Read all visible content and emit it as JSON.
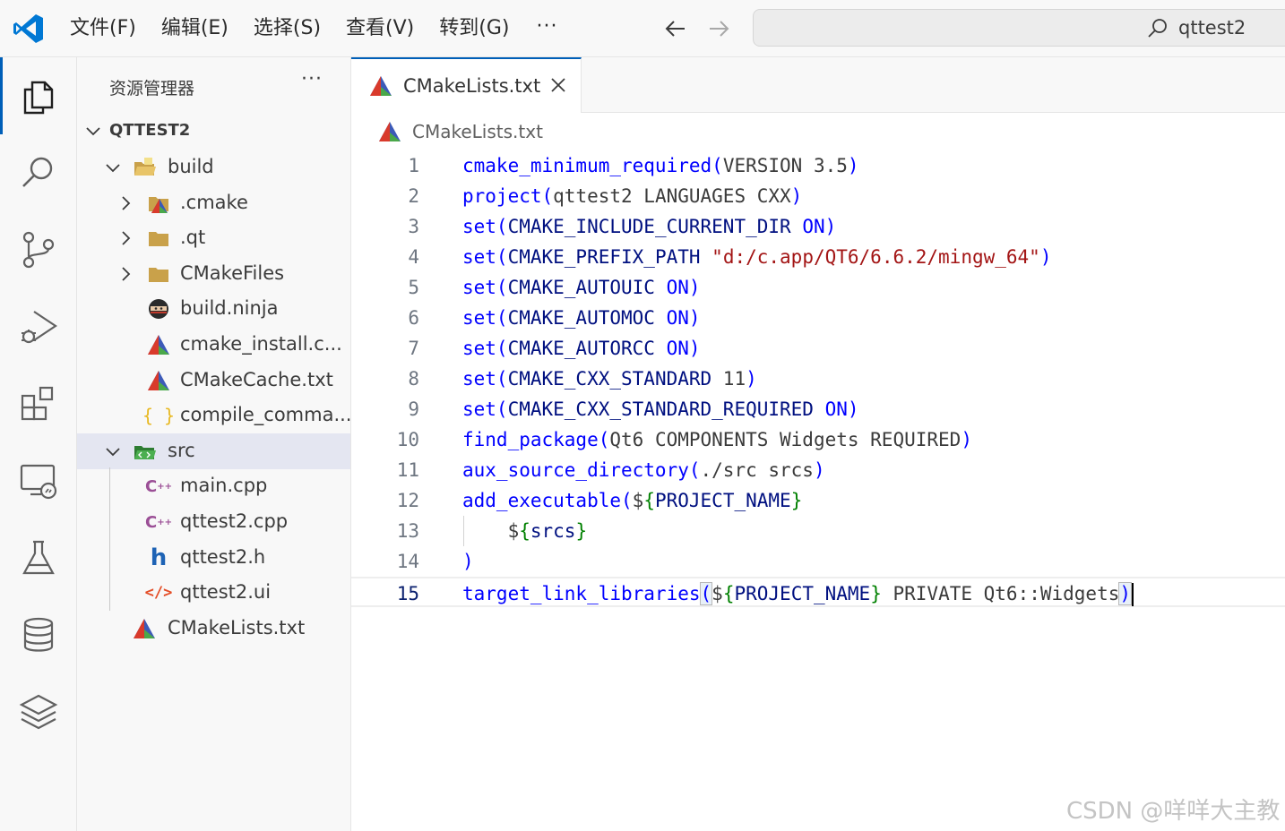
{
  "menu": {
    "items": [
      "文件(F)",
      "编辑(E)",
      "选择(S)",
      "查看(V)",
      "转到(G)"
    ],
    "more": "···"
  },
  "command_center": {
    "text": "qttest2"
  },
  "activity": [
    "explorer-icon",
    "search-icon",
    "source-control-icon",
    "run-debug-icon",
    "extensions-icon",
    "remote-explorer-icon",
    "testing-icon",
    "database-icon",
    "layers-icon"
  ],
  "sidebar": {
    "title": "资源管理器",
    "more": "···",
    "root": "QTTEST2",
    "items": [
      {
        "label": "build"
      },
      {
        "label": ".cmake"
      },
      {
        "label": ".qt"
      },
      {
        "label": "CMakeFiles"
      },
      {
        "label": "build.ninja"
      },
      {
        "label": "cmake_install.c..."
      },
      {
        "label": "CMakeCache.txt"
      },
      {
        "label": "compile_comma..."
      },
      {
        "label": "src"
      },
      {
        "label": "main.cpp"
      },
      {
        "label": "qttest2.cpp"
      },
      {
        "label": "qttest2.h"
      },
      {
        "label": "qttest2.ui"
      },
      {
        "label": "CMakeLists.txt"
      }
    ]
  },
  "editor": {
    "tab": "CMakeLists.txt",
    "breadcrumb": "CMakeLists.txt",
    "line_numbers": [
      "1",
      "2",
      "3",
      "4",
      "5",
      "6",
      "7",
      "8",
      "9",
      "10",
      "11",
      "12",
      "13",
      "14",
      "15"
    ],
    "current_line": "15"
  },
  "colors": {
    "accent": "#005fb8",
    "keyword": "#0000ff",
    "string": "#a31515",
    "variable": "#001080",
    "brace": "#008000"
  },
  "watermark": "CSDN @咩咩大主教"
}
